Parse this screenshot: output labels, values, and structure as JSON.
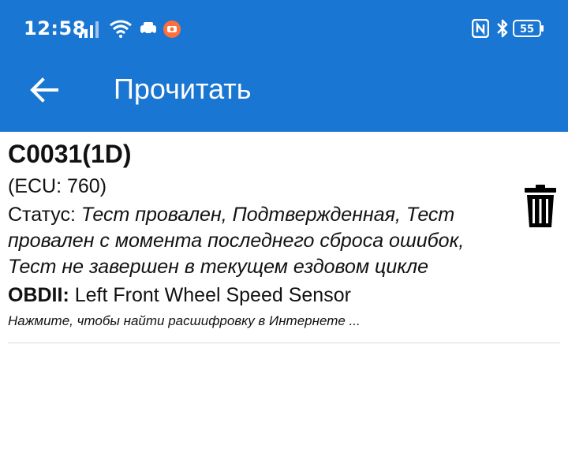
{
  "status_bar": {
    "time": "12:58",
    "battery": "55",
    "icons": [
      "signal-icon",
      "wifi-icon",
      "car-app-icon",
      "camera-app-icon",
      "nfc-icon",
      "bluetooth-icon",
      "battery-icon"
    ]
  },
  "app_bar": {
    "title": "Прочитать",
    "back_icon": "arrow-left-icon",
    "color": "#1976d2"
  },
  "dtc": {
    "code": "C0031(1D)",
    "ecu": "(ECU: 760)",
    "status_label": "Статус: ",
    "status_value": "Тест провален, Подтвержденная, Тест провален с момента последнего сброса ошибок, Тест не завершен в текущем ездовом цикле",
    "obd_label": "OBDII:",
    "obd_value": " Left Front Wheel Speed Sensor",
    "hint": "Нажмите, чтобы найти расшифровку в Интернете ...",
    "delete_icon": "trash-icon"
  }
}
